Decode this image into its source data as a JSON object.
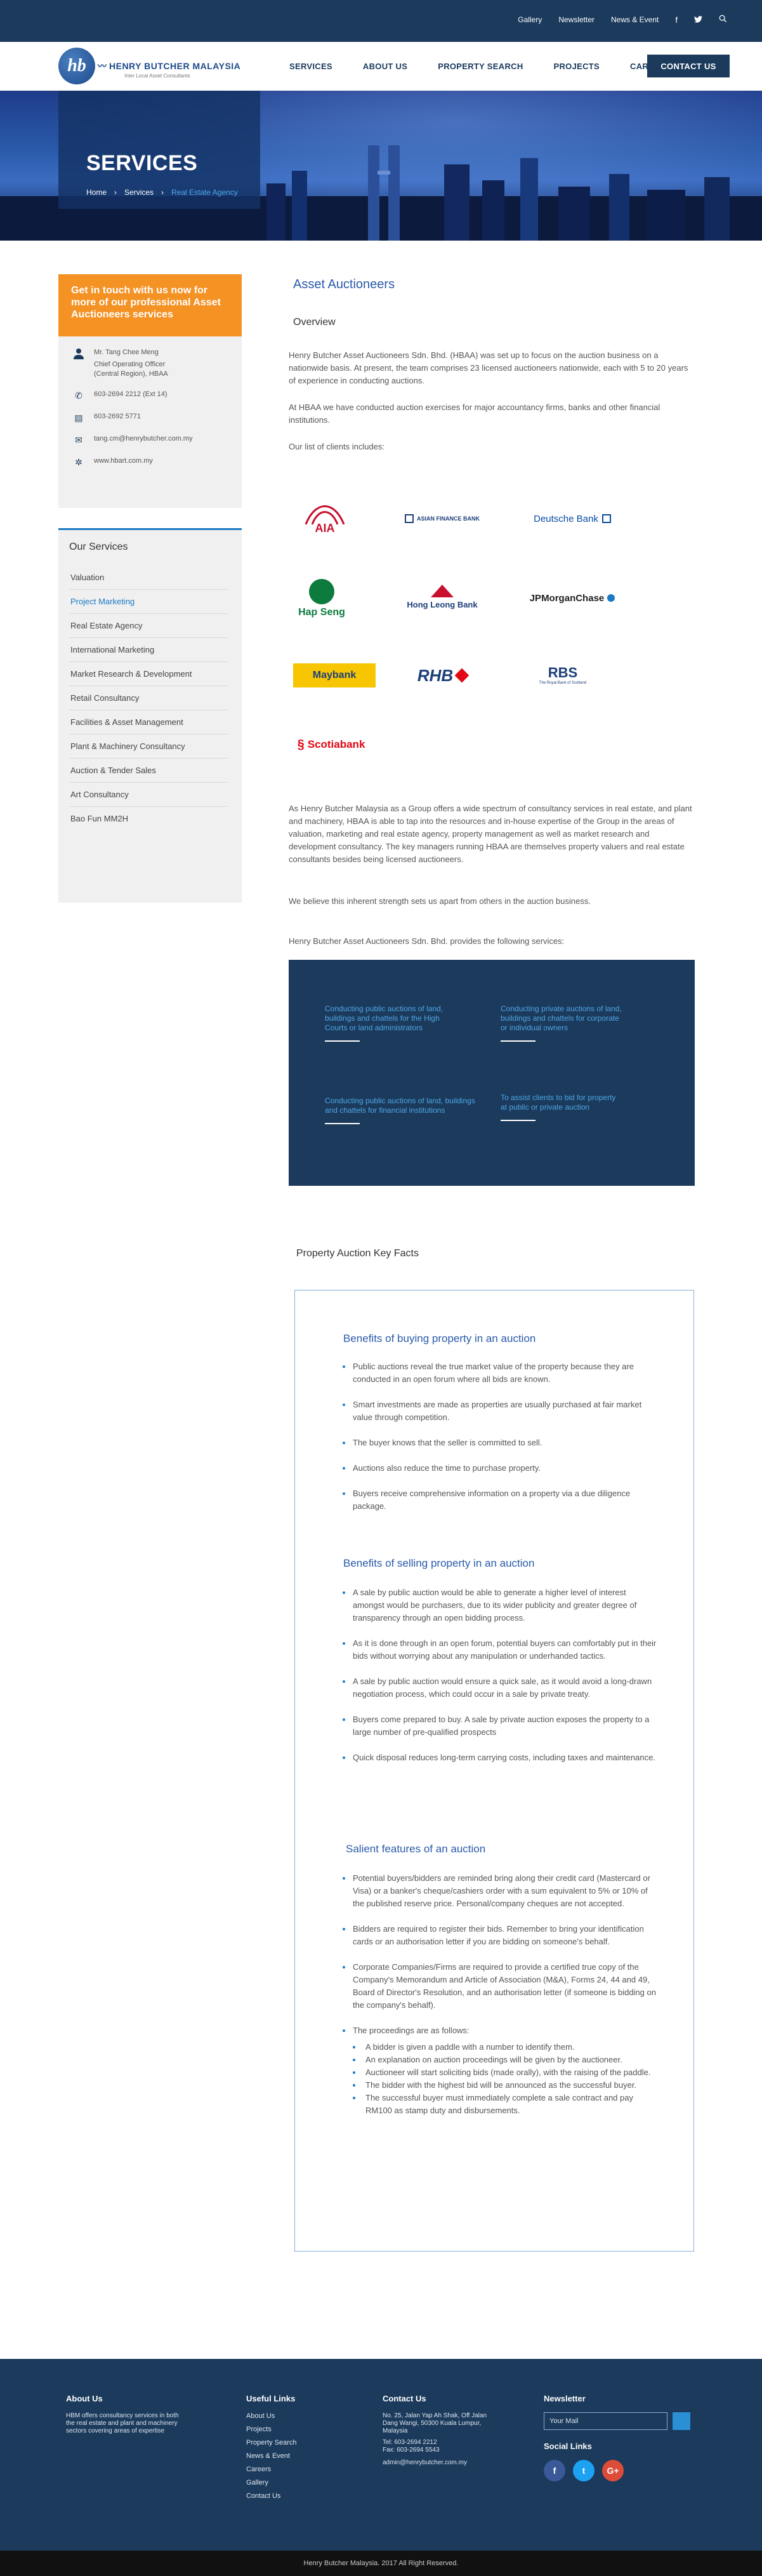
{
  "topbar": {
    "links": [
      "Gallery",
      "Newsletter",
      "News & Event"
    ]
  },
  "logo": {
    "mark": "hb",
    "name": "HENRY BUTCHER MALAYSIA",
    "tagline": "Inter Local Asset Consultants"
  },
  "nav": {
    "items": [
      "SERVICES",
      "ABOUT US",
      "PROPERTY SEARCH",
      "PROJECTS",
      "CAREERS"
    ],
    "contact": "CONTACT US"
  },
  "hero": {
    "title": "SERVICES",
    "breadcrumb": [
      "Home",
      "Services",
      "Real Estate Agency"
    ]
  },
  "sidebar": {
    "cta": "Get in touch with us now for more of our professional Asset Auctioneers services",
    "contact": {
      "name": "Mr. Tang Chee Meng",
      "role": "Chief Operating Officer (Central Region), HBAA",
      "phone": "603-2694 2212 (Ext 14)",
      "fax": "603-2692 5771",
      "email": "tang.cm@henrybutcher.com.my",
      "web": "www.hbart.com.my"
    },
    "services_title": "Our Services",
    "services": [
      "Valuation",
      "Project Marketing",
      "Real Estate Agency",
      "International Marketing",
      "Market Research & Development",
      "Retail Consultancy",
      "Facilities & Asset Management",
      "Plant & Machinery Consultancy",
      "Auction & Tender Sales",
      "Art Consultancy",
      "Bao Fun MM2H"
    ]
  },
  "main": {
    "title": "Asset Auctioneers",
    "overview": "Overview",
    "p1": "Henry Butcher Asset Auctioneers Sdn. Bhd. (HBAA) was set up to focus on the auction business on a nationwide basis. At present, the team comprises 23 licensed auctioneers nationwide, each with 5 to 20 years of experience in conducting auctions.",
    "p2": "At HBAA we have conducted auction exercises for major accountancy firms, banks and other financial institutions.",
    "p3": "Our list of clients includes:",
    "clients": [
      "AIA",
      "ASIAN FINANCE BANK",
      "Deutsche Bank",
      "Hap Seng",
      "Hong Leong Bank",
      "JPMorganChase",
      "Maybank",
      "RHB",
      "RBS",
      "The Royal Bank of Scotland",
      "Scotiabank"
    ],
    "p4": "As Henry Butcher Malaysia as a Group offers a wide spectrum of consultancy services in real estate, and plant and machinery, HBAA is able to tap into the resources and in-house expertise of the Group in the areas of valuation, marketing and real estate agency, property management as well as market research and development consultancy. The key managers running HBAA are themselves property valuers and real estate consultants besides being licensed auctioneers.",
    "p5": "We believe this inherent strength sets us apart from others in the auction business.",
    "p6": "Henry Butcher Asset Auctioneers Sdn. Bhd. provides the following services:",
    "services": [
      "Conducting public auctions of land, buildings and chattels for the High Courts or land administrators",
      "Conducting private auctions of land, buildings and chattels for corporate or individual owners",
      "Conducting public auctions of land, buildings and chattels for financial institutions",
      "To assist clients to bid for property at public or private auction"
    ]
  },
  "keyfacts": {
    "title": "Property Auction Key Facts",
    "buying_title": "Benefits of buying property in an auction",
    "buying": [
      "Public auctions reveal the true market value of the property because they are conducted in an open forum where all bids are known.",
      "Smart investments are made as properties are usually purchased at fair market value through competition.",
      "The buyer knows that the seller is committed to sell.",
      "Auctions also reduce the time to purchase property.",
      "Buyers receive comprehensive information on a property via a due diligence package."
    ],
    "selling_title": "Benefits of selling property in an auction",
    "selling": [
      "A sale by public auction would be able to generate a higher level of interest amongst would be purchasers, due to its wider publicity and greater degree of transparency through an open bidding process.",
      "As it is done through in an open forum, potential buyers can comfortably put in their bids without worrying about any manipulation or underhanded tactics.",
      "A sale by public auction would ensure a quick sale, as it would avoid a long-drawn negotiation process, which could occur in a sale by private treaty.",
      "Buyers come prepared to buy. A sale by private auction exposes the property to a large number of pre-qualified prospects",
      "Quick disposal reduces long-term carrying costs, including taxes and maintenance."
    ],
    "salient_title": "Salient features of an auction",
    "salient": [
      "Potential buyers/bidders are reminded bring along their credit card (Mastercard or Visa) or a banker's cheque/cashiers order with a sum equivalent to 5% or 10% of the published reserve price. Personal/company cheques are not accepted.",
      "Bidders are required to register their bids. Remember to bring your identification cards or an authorisation letter if you are bidding on someone's behalf.",
      "Corporate Companies/Firms are required to provide a certified true copy of the Company's Memorandum and Article of Association (M&A), Forms 24, 44 and 49, Board of Director's Resolution, and an authorisation letter (if someone is bidding on the company's behalf).",
      "The proceedings are as follows:"
    ],
    "proceedings": [
      "A bidder is given a paddle with a number to identify them.",
      "An explanation on auction proceedings will be given by the auctioneer.",
      "Auctioneer will start soliciting bids (made orally), with the raising of the paddle.",
      "The bidder with the highest bid will be announced as the successful buyer.",
      "The successful buyer must immediately complete a sale contract and pay RM100 as stamp duty and disbursements."
    ]
  },
  "footer": {
    "about_title": "About Us",
    "about_text": "HBM offers consultancy services in both the real estate and plant and machinery sectors covering areas of expertise",
    "links_title": "Useful Links",
    "links": [
      "About Us",
      "Projects",
      "Property Search",
      "News & Event",
      "Careers",
      "Gallery",
      "Contact Us"
    ],
    "contact_title": "Contact Us",
    "address": "No. 25, Jalan Yap Ah Shak, Off Jalan Dang Wangi, 50300 Kuala Lumpur, Malaysia",
    "tel": "Tel: 603-2694 2212",
    "fax": "Fax: 603-2694 5543",
    "email": "admin@henrybutcher.com.my",
    "newsletter_title": "Newsletter",
    "newsletter_placeholder": "Your Mail",
    "social_title": "Social Links",
    "copyright": "Henry Butcher Malaysia. 2017 All Right Reserved."
  },
  "colors": {
    "navy": "#1b3a5c",
    "orange": "#f49224",
    "accent": "#1b7ac4"
  }
}
